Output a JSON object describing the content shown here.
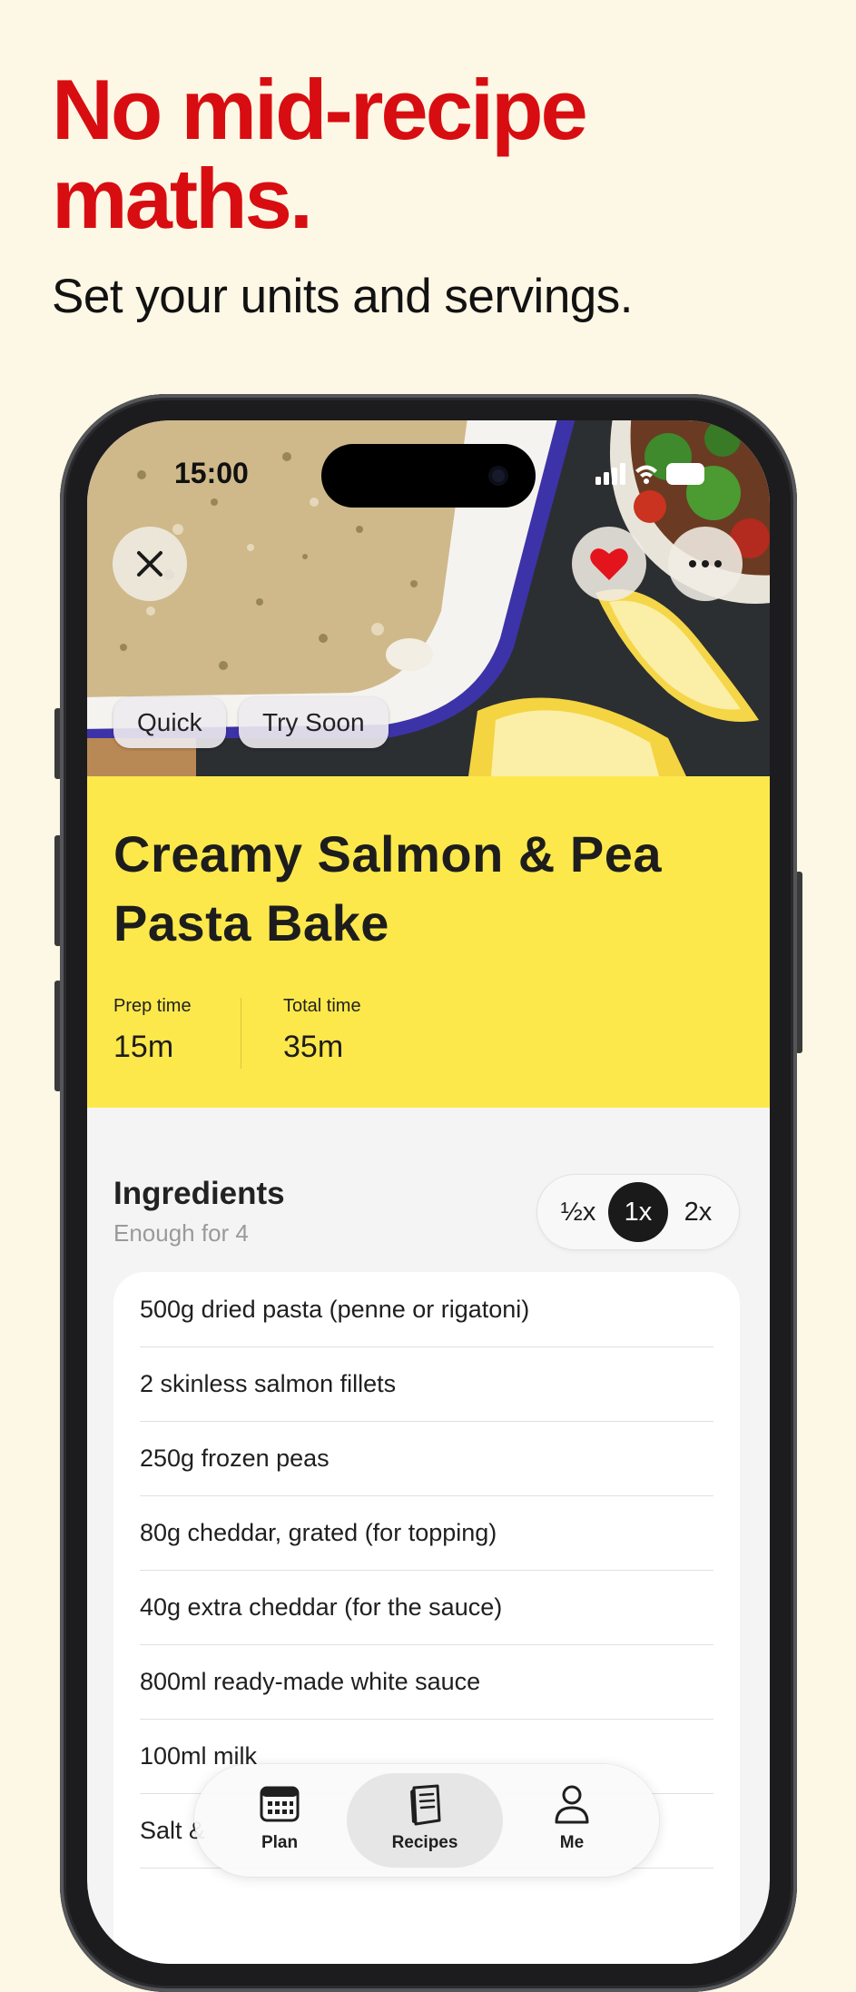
{
  "marketing": {
    "headline": "No mid-recipe maths.",
    "subhead": "Set your units and servings."
  },
  "status_bar": {
    "time": "15:00"
  },
  "hero": {
    "close_icon": "close-icon",
    "favorite_icon": "heart-icon",
    "more_icon": "ellipsis-icon",
    "favorite_color": "#e3141b",
    "tags": [
      "Quick",
      "Try Soon"
    ]
  },
  "recipe": {
    "title": "Creamy Salmon & Pea Pasta Bake",
    "prep_label": "Prep time",
    "prep_value": "15m",
    "total_label": "Total time",
    "total_value": "35m",
    "panel_color": "#fde84b"
  },
  "ingredients": {
    "heading": "Ingredients",
    "servings_text": "Enough for 4",
    "scale_options": [
      "½x",
      "1x",
      "2x"
    ],
    "selected_scale": "1x",
    "items": [
      "500g dried pasta (penne or rigatoni)",
      "2 skinless salmon fillets",
      "250g frozen peas",
      "80g cheddar, grated (for topping)",
      "40g extra cheddar (for the sauce)",
      "800ml ready-made white sauce",
      "100ml milk",
      "Salt &"
    ]
  },
  "tabbar": {
    "tabs": [
      {
        "label": "Plan",
        "icon": "calendar-icon"
      },
      {
        "label": "Recipes",
        "icon": "book-icon"
      },
      {
        "label": "Me",
        "icon": "person-icon"
      }
    ],
    "active": "Recipes"
  },
  "colors": {
    "page_background": "#fdf7e5",
    "headline": "#d80d11",
    "accent_yellow": "#fde84b"
  }
}
